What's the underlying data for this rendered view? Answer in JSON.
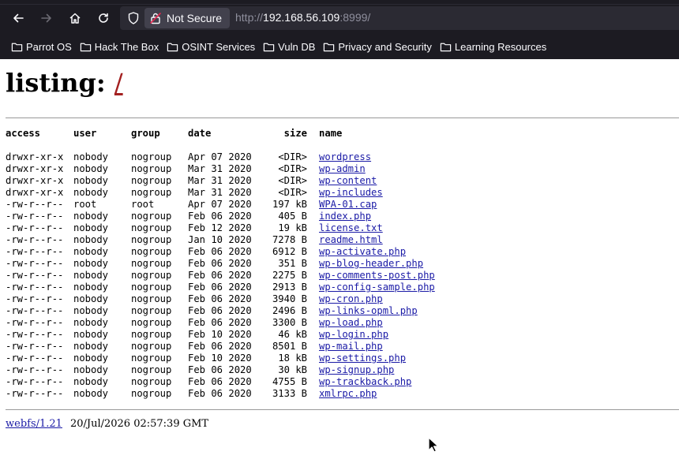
{
  "browser": {
    "security_label": "Not Secure",
    "url_scheme": "http://",
    "url_host": "192.168.56.109",
    "url_rest": ":8999/",
    "icons": {
      "back": "arrow-left-icon",
      "forward": "arrow-right-icon",
      "home": "home-icon",
      "reload": "reload-icon",
      "shield": "shield-icon",
      "lock": "broken-lock-icon",
      "folder": "folder-icon"
    },
    "bookmarks": [
      "Parrot OS",
      "Hack The Box",
      "OSINT Services",
      "Vuln DB",
      "Privacy and Security",
      "Learning Resources"
    ]
  },
  "page": {
    "title_prefix": "listing: ",
    "title_path": "/",
    "columns": {
      "access": "access",
      "user": "user",
      "group": "group",
      "date": "date",
      "size": "size",
      "name": "name"
    },
    "rows": [
      {
        "access": "drwxr-xr-x",
        "user": "nobody",
        "group": "nogroup",
        "date": "Apr 07  2020",
        "size": "<DIR>",
        "name": "wordpress"
      },
      {
        "access": "drwxr-xr-x",
        "user": "nobody",
        "group": "nogroup",
        "date": "Mar 31  2020",
        "size": "<DIR>",
        "name": "wp-admin"
      },
      {
        "access": "drwxr-xr-x",
        "user": "nobody",
        "group": "nogroup",
        "date": "Mar 31  2020",
        "size": "<DIR>",
        "name": "wp-content"
      },
      {
        "access": "drwxr-xr-x",
        "user": "nobody",
        "group": "nogroup",
        "date": "Mar 31  2020",
        "size": "<DIR>",
        "name": "wp-includes"
      },
      {
        "access": "-rw-r--r--",
        "user": "root",
        "group": "root",
        "date": "Apr 07  2020",
        "size": "197 kB",
        "name": "WPA-01.cap"
      },
      {
        "access": "-rw-r--r--",
        "user": "nobody",
        "group": "nogroup",
        "date": "Feb 06  2020",
        "size": "405  B",
        "name": "index.php"
      },
      {
        "access": "-rw-r--r--",
        "user": "nobody",
        "group": "nogroup",
        "date": "Feb 12  2020",
        "size": "19 kB",
        "name": "license.txt"
      },
      {
        "access": "-rw-r--r--",
        "user": "nobody",
        "group": "nogroup",
        "date": "Jan 10  2020",
        "size": "7278  B",
        "name": "readme.html"
      },
      {
        "access": "-rw-r--r--",
        "user": "nobody",
        "group": "nogroup",
        "date": "Feb 06  2020",
        "size": "6912  B",
        "name": "wp-activate.php"
      },
      {
        "access": "-rw-r--r--",
        "user": "nobody",
        "group": "nogroup",
        "date": "Feb 06  2020",
        "size": "351  B",
        "name": "wp-blog-header.php"
      },
      {
        "access": "-rw-r--r--",
        "user": "nobody",
        "group": "nogroup",
        "date": "Feb 06  2020",
        "size": "2275  B",
        "name": "wp-comments-post.php"
      },
      {
        "access": "-rw-r--r--",
        "user": "nobody",
        "group": "nogroup",
        "date": "Feb 06  2020",
        "size": "2913  B",
        "name": "wp-config-sample.php"
      },
      {
        "access": "-rw-r--r--",
        "user": "nobody",
        "group": "nogroup",
        "date": "Feb 06  2020",
        "size": "3940  B",
        "name": "wp-cron.php"
      },
      {
        "access": "-rw-r--r--",
        "user": "nobody",
        "group": "nogroup",
        "date": "Feb 06  2020",
        "size": "2496  B",
        "name": "wp-links-opml.php"
      },
      {
        "access": "-rw-r--r--",
        "user": "nobody",
        "group": "nogroup",
        "date": "Feb 06  2020",
        "size": "3300  B",
        "name": "wp-load.php"
      },
      {
        "access": "-rw-r--r--",
        "user": "nobody",
        "group": "nogroup",
        "date": "Feb 10  2020",
        "size": "46 kB",
        "name": "wp-login.php"
      },
      {
        "access": "-rw-r--r--",
        "user": "nobody",
        "group": "nogroup",
        "date": "Feb 06  2020",
        "size": "8501  B",
        "name": "wp-mail.php"
      },
      {
        "access": "-rw-r--r--",
        "user": "nobody",
        "group": "nogroup",
        "date": "Feb 10  2020",
        "size": "18 kB",
        "name": "wp-settings.php"
      },
      {
        "access": "-rw-r--r--",
        "user": "nobody",
        "group": "nogroup",
        "date": "Feb 06  2020",
        "size": "30 kB",
        "name": "wp-signup.php"
      },
      {
        "access": "-rw-r--r--",
        "user": "nobody",
        "group": "nogroup",
        "date": "Feb 06  2020",
        "size": "4755  B",
        "name": "wp-trackback.php"
      },
      {
        "access": "-rw-r--r--",
        "user": "nobody",
        "group": "nogroup",
        "date": "Feb 06  2020",
        "size": "3133  B",
        "name": "xmlrpc.php"
      }
    ],
    "footer": {
      "server_link": "webfs/1.21",
      "timestamp": "20/Jul/2026 02:57:39 GMT"
    }
  }
}
